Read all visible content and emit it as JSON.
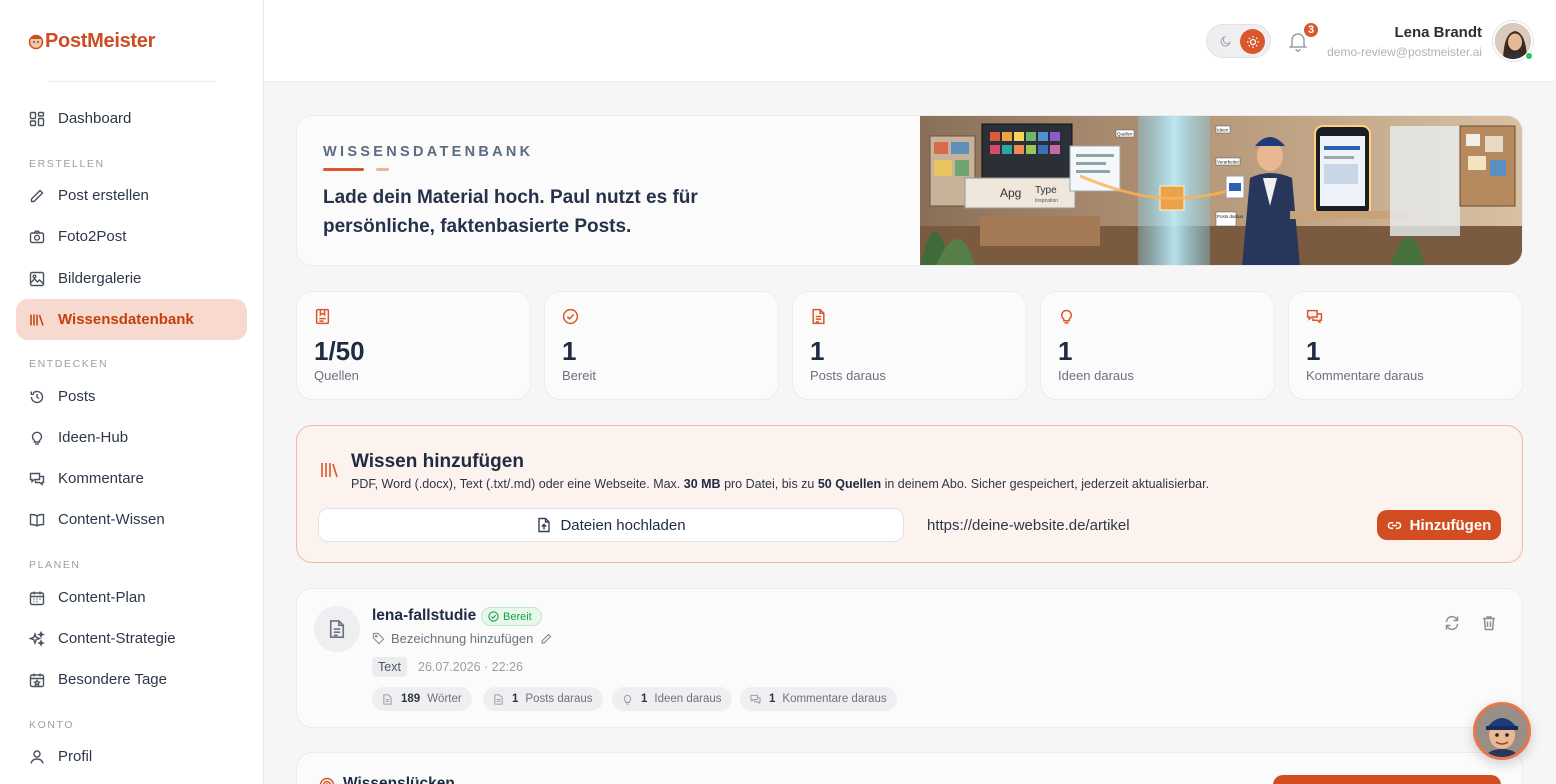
{
  "brand": {
    "part1": "Post",
    "part2": "Meister"
  },
  "sidebar": {
    "items": [
      {
        "label": "Dashboard",
        "icon": "grid-icon"
      },
      {
        "section": "ERSTELLEN"
      },
      {
        "label": "Post erstellen",
        "icon": "pencil-icon"
      },
      {
        "label": "Foto2Post",
        "icon": "camera-icon"
      },
      {
        "label": "Bildergalerie",
        "icon": "image-icon"
      },
      {
        "label": "Wissensdatenbank",
        "icon": "library-icon",
        "active": true
      },
      {
        "section": "ENTDECKEN"
      },
      {
        "label": "Posts",
        "icon": "history-icon"
      },
      {
        "label": "Ideen-Hub",
        "icon": "lightbulb-icon"
      },
      {
        "label": "Kommentare",
        "icon": "chat-icon"
      },
      {
        "label": "Content-Wissen",
        "icon": "book-icon"
      },
      {
        "section": "PLANEN"
      },
      {
        "label": "Content-Plan",
        "icon": "calendar-icon"
      },
      {
        "label": "Content-Strategie",
        "icon": "sparkles-icon"
      },
      {
        "label": "Besondere Tage",
        "icon": "calendar-star-icon"
      },
      {
        "section": "KONTO"
      },
      {
        "label": "Profil",
        "icon": "user-icon"
      }
    ],
    "sections": {
      "create": "ERSTELLEN",
      "discover": "ENTDECKEN",
      "plan": "PLANEN",
      "account": "KONTO"
    },
    "labels": {
      "dashboard": "Dashboard",
      "post_create": "Post erstellen",
      "foto2post": "Foto2Post",
      "gallery": "Bildergalerie",
      "knowledge": "Wissensdatenbank",
      "posts": "Posts",
      "ideas": "Ideen-Hub",
      "comments": "Kommentare",
      "content_knowledge": "Content-Wissen",
      "content_plan": "Content-Plan",
      "content_strategy": "Content-Strategie",
      "special_days": "Besondere Tage",
      "profile": "Profil"
    }
  },
  "header": {
    "notifications_count": "3",
    "user_name": "Lena Brandt",
    "user_email": "demo-review@postmeister.ai"
  },
  "hero": {
    "kicker": "WISSENSDATENBANK",
    "text": "Lade dein Material hoch. Paul nutzt es für persönliche, faktenbasierte Posts.",
    "illustration_labels": [
      "Apg",
      "Type",
      "Inspiration",
      "Quellen",
      "Ideen",
      "Verarbeitet",
      "Posts daraus"
    ]
  },
  "stats": [
    {
      "value": "1/50",
      "label": "Quellen",
      "icon": "bookmark-icon"
    },
    {
      "value": "1",
      "label": "Bereit",
      "icon": "check-circle-icon"
    },
    {
      "value": "1",
      "label": "Posts daraus",
      "icon": "document-icon"
    },
    {
      "value": "1",
      "label": "Ideen daraus",
      "icon": "lightbulb-icon"
    },
    {
      "value": "1",
      "label": "Kommentare daraus",
      "icon": "chat-icon"
    }
  ],
  "add_knowledge": {
    "title": "Wissen hinzufügen",
    "desc_1": "PDF, Word (.docx), Text (.txt/.md) oder eine Webseite. Max. ",
    "desc_b1": "30 MB",
    "desc_2": " pro Datei, bis zu ",
    "desc_b2": "50 Quellen",
    "desc_3": " in deinem Abo. Sicher gespeichert, jederzeit aktualisierbar.",
    "upload_label": "Dateien hochladen",
    "url_value": "https://deine-website.de/artikel",
    "add_label": "Hinzufügen"
  },
  "source": {
    "name": "lena-fallstudie",
    "status": "Bereit",
    "label_placeholder": "Bezeichnung hinzufügen",
    "type": "Text",
    "date": "26.07.2026 · 22:26",
    "pills": [
      {
        "count": "189",
        "label": "Wörter"
      },
      {
        "count": "1",
        "label": "Posts daraus"
      },
      {
        "count": "1",
        "label": "Ideen daraus"
      },
      {
        "count": "1",
        "label": "Kommentare daraus"
      }
    ]
  },
  "next_section": {
    "title": "Wissenslücken"
  },
  "colors": {
    "accent": "#d9572b",
    "active_bg": "#f7d9cf",
    "ready_green": "#16a34a"
  }
}
